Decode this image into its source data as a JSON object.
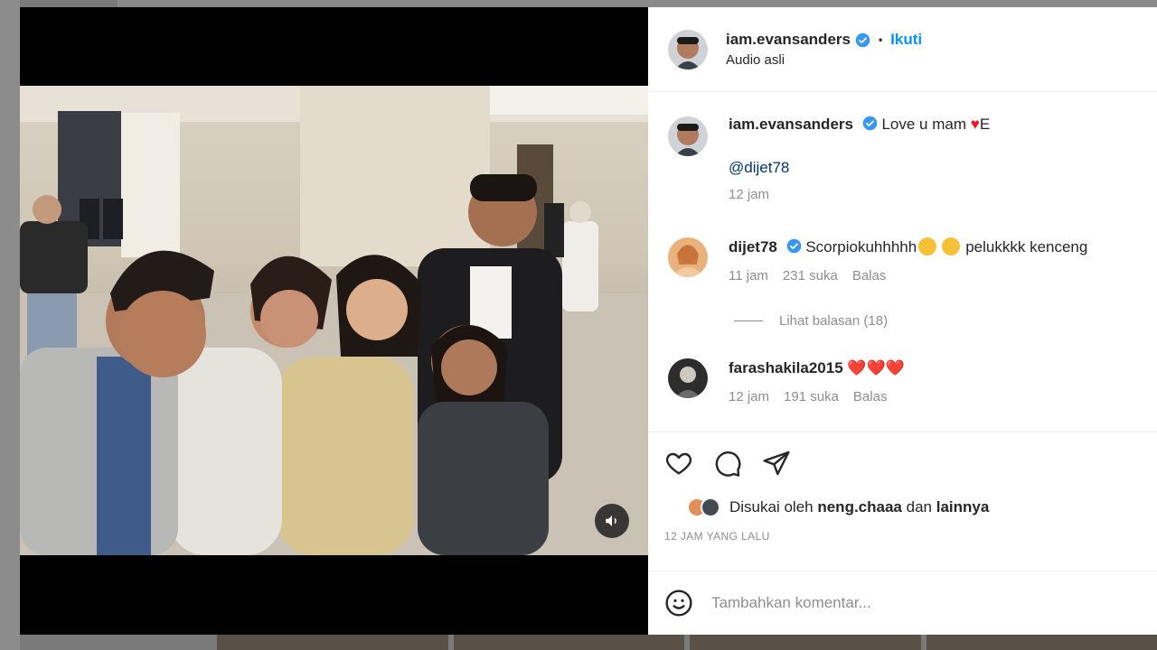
{
  "post": {
    "author": "iam.evansanders",
    "follow_label": "Ikuti",
    "separator": "•",
    "audio": "Audio asli",
    "caption": "Love u mam",
    "caption_suffix": "E",
    "mention": "@dijet78",
    "caption_time": "12 jam"
  },
  "comments": [
    {
      "user": "dijet78",
      "verified": true,
      "text": "Scorpiokuhhhhh",
      "text_end": "pelukkkk kenceng",
      "time": "11 jam",
      "likes": "231 suka",
      "reply": "Balas"
    },
    {
      "user": "farashakila2015",
      "verified": false,
      "text": "❤️❤️❤️",
      "time": "12 jam",
      "likes": "191 suka",
      "reply": "Balas"
    }
  ],
  "view_replies": "Lihat balasan (18)",
  "likes": {
    "prefix": "Disukai oleh",
    "user": "neng.chaaa",
    "conj": "dan",
    "others": "lainnya"
  },
  "timestamp": "12 JAM YANG LALU",
  "comment_input": {
    "placeholder": "Tambahkan komentar..."
  },
  "icons": {
    "like": "heart-icon",
    "comment": "comment-icon",
    "share": "send-icon",
    "emoji": "emoji-icon",
    "mute": "volume-icon",
    "verified": "verified-badge-icon"
  },
  "colors": {
    "accent": "#0095f6",
    "verified": "#3897f0",
    "heart": "#ed1c24",
    "muted_text": "#8e8e8e"
  }
}
